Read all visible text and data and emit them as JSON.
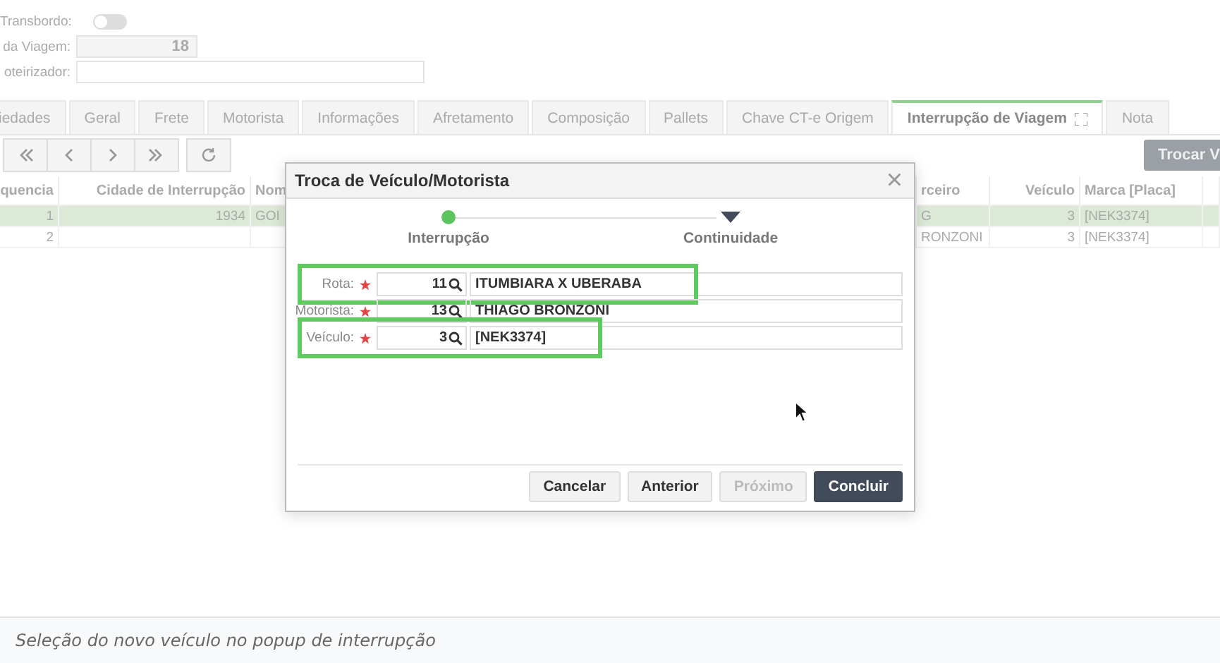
{
  "form": {
    "fields": [
      {
        "label": "Transbordo:",
        "kind": "toggle",
        "on": false
      },
      {
        "label": "da Viagem:",
        "kind": "number",
        "value": "18"
      },
      {
        "label": "oteirizador:",
        "kind": "text"
      }
    ]
  },
  "tabs": [
    {
      "label": "iedades",
      "selected": false
    },
    {
      "label": "Geral",
      "selected": false
    },
    {
      "label": "Frete",
      "selected": false
    },
    {
      "label": "Motorista",
      "selected": false
    },
    {
      "label": "Informações",
      "selected": false
    },
    {
      "label": "Afretamento",
      "selected": false
    },
    {
      "label": "Composição",
      "selected": false
    },
    {
      "label": "Pallets",
      "selected": false
    },
    {
      "label": "Chave CT-e Origem",
      "selected": false
    },
    {
      "label": "Interrupção de Viagem",
      "selected": true
    },
    {
      "label": "Nota",
      "selected": false
    }
  ],
  "action_button": "Trocar V",
  "table": {
    "columns": [
      "quencia",
      "Cidade de Interrupção",
      "Nom",
      "rceiro",
      "Veículo",
      "Marca [Placa]"
    ],
    "rows": [
      {
        "selected": true,
        "cells": [
          "1",
          "1934",
          "GOI",
          "G",
          "3",
          "[NEK3374]"
        ]
      },
      {
        "selected": false,
        "cells": [
          "2",
          null,
          null,
          "RONZONI",
          "3",
          "[NEK3374]"
        ]
      }
    ]
  },
  "dialog": {
    "title": "Troca de Veículo/Motorista",
    "close": "×",
    "steps": [
      {
        "label": "Interrupção",
        "selected": true
      },
      {
        "label": "Continuidade",
        "selected": false
      }
    ],
    "fields": [
      {
        "label": "Rota:",
        "required": true,
        "code": "11",
        "description": "ITUMBIARA X UBERABA",
        "highlighted": true
      },
      {
        "label": "Motorista:",
        "required": true,
        "code": "13",
        "description": "THIAGO BRONZONI",
        "highlighted": false
      },
      {
        "label": "Veículo:",
        "required": true,
        "code": "3",
        "description": "[NEK3374]",
        "highlighted": true
      }
    ],
    "buttons": [
      {
        "label": "Cancelar",
        "kind": "default",
        "disabled": false
      },
      {
        "label": "Anterior",
        "kind": "default",
        "disabled": false
      },
      {
        "label": "Próximo",
        "kind": "default",
        "disabled": true
      },
      {
        "label": "Concluir",
        "kind": "primary",
        "disabled": false
      }
    ]
  },
  "caption": "Seleção do novo veículo no popup de interrupção"
}
